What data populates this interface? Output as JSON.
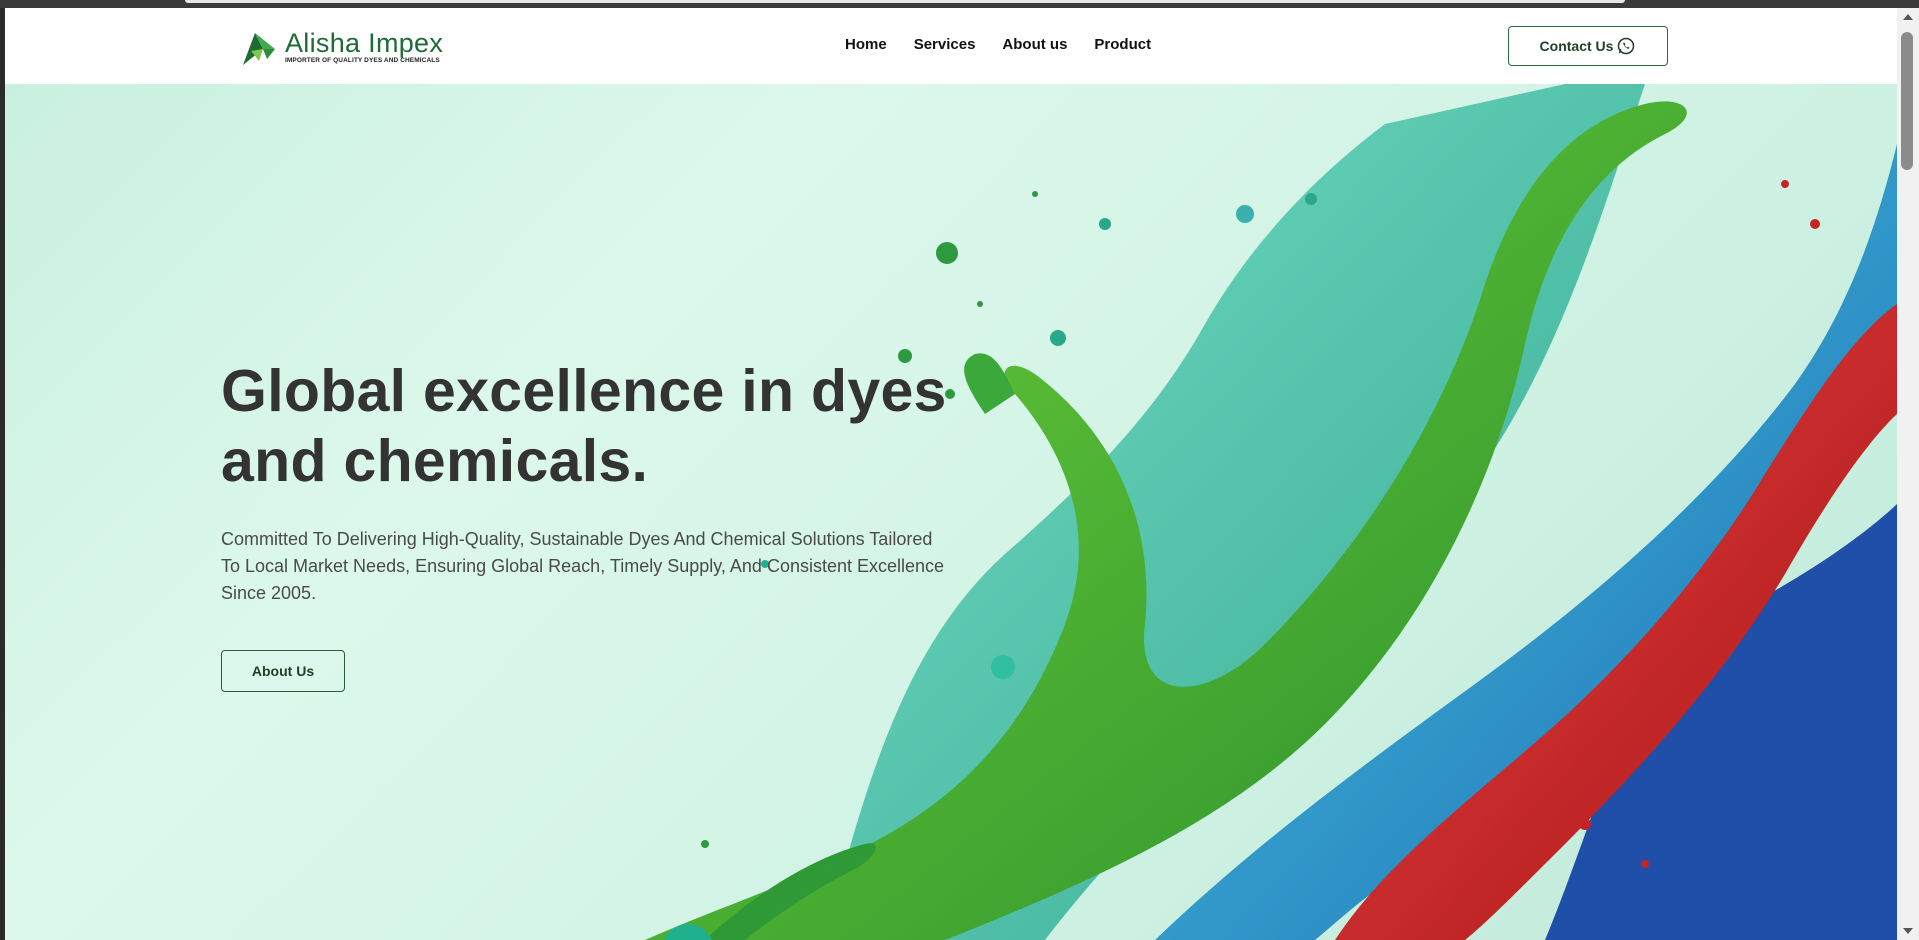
{
  "brand": {
    "name": "Alisha Impex",
    "tagline": "IMPORTER OF QUALITY DYES AND CHEMICALS",
    "primary_color": "#1f6b35"
  },
  "nav": {
    "items": [
      {
        "label": "Home"
      },
      {
        "label": "Services"
      },
      {
        "label": "About us"
      },
      {
        "label": "Product"
      }
    ],
    "contact_label": "Contact Us",
    "contact_icon": "whatsapp-icon"
  },
  "hero": {
    "headline": "Global excellence in dyes and chemicals.",
    "description": "Committed To Delivering High-Quality, Sustainable Dyes And Chemical Solutions Tailored To Local Market Needs, Ensuring Global Reach, Timely Supply, And Consistent Excellence Since 2005.",
    "cta_label": "About Us"
  },
  "colors": {
    "hero_background": "#d3f4e6",
    "splash_green": "#3aa83a",
    "splash_teal": "#2fbfa0",
    "splash_blue": "#1e88c8",
    "splash_red": "#d42a2a",
    "splash_navy": "#1f4fa8"
  }
}
